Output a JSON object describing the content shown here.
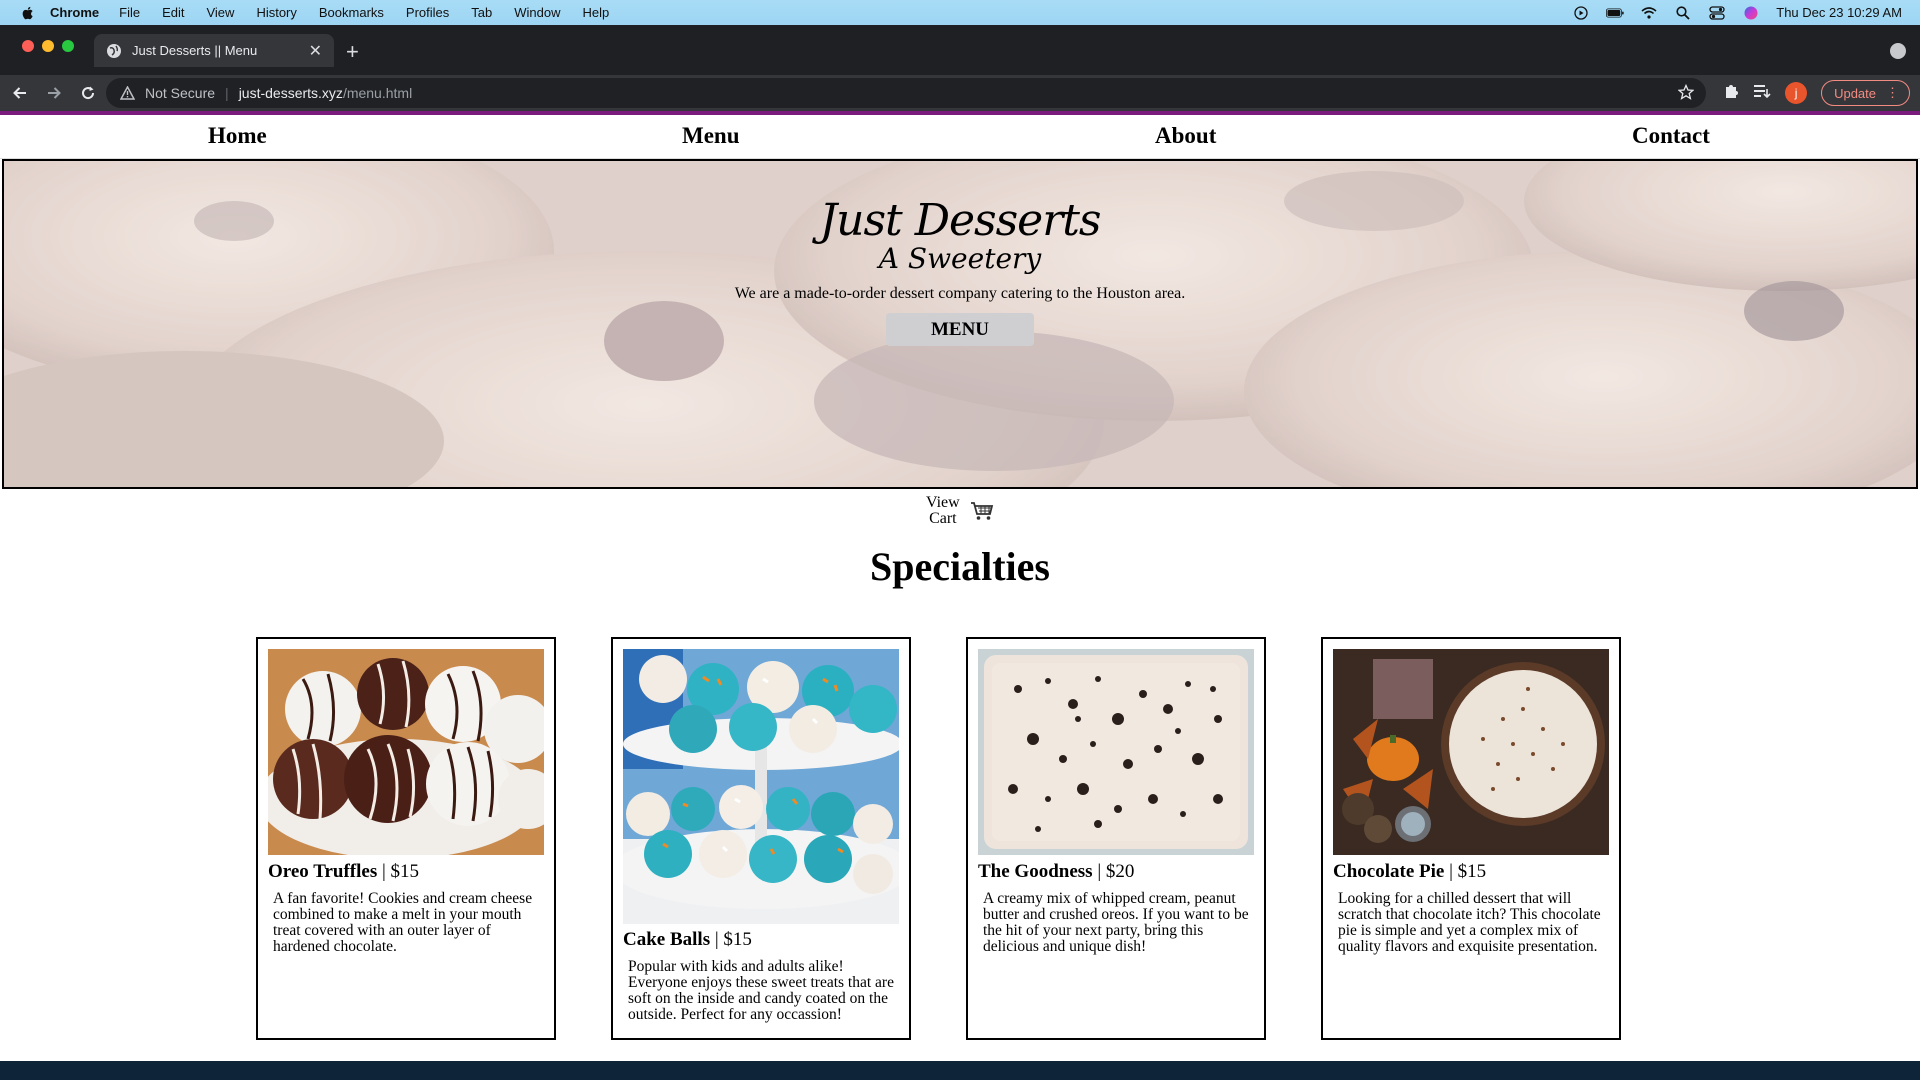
{
  "os_menubar": {
    "app_name": "Chrome",
    "menus": [
      "File",
      "Edit",
      "View",
      "History",
      "Bookmarks",
      "Profiles",
      "Tab",
      "Window",
      "Help"
    ],
    "clock": "Thu Dec 23  10:29 AM"
  },
  "browser": {
    "tab_title": "Just Desserts || Menu",
    "security_label": "Not Secure",
    "url_host": "just-desserts.xyz",
    "url_path": "/menu.html",
    "profile_initial": "j",
    "update_label": "Update"
  },
  "site": {
    "nav": [
      "Home",
      "Menu",
      "About",
      "Contact"
    ],
    "hero": {
      "title": "Just Desserts",
      "subtitle": "A Sweetery",
      "description": "We are a made-to-order dessert company catering to the Houston area.",
      "button": "MENU"
    },
    "cart": {
      "line1": "View",
      "line2": "Cart"
    },
    "section_title": "Specialties",
    "items": [
      {
        "name": "Oreo Truffles",
        "price": " | $15",
        "description": "A fan favorite! Cookies and cream cheese combined to make a melt in your mouth treat covered with an outer layer of hardened chocolate."
      },
      {
        "name": "Cake Balls",
        "price": " | $15",
        "description": "Popular with kids and adults alike! Everyone enjoys these sweet treats that are soft on the inside and candy coated on the outside. Perfect for any occassion!"
      },
      {
        "name": "The Goodness",
        "price": " | $20",
        "description": "A creamy mix of whipped cream, peanut butter and crushed oreos. If you want to be the hit of your next party, bring this delicious and unique dish!"
      },
      {
        "name": "Chocolate Pie",
        "price": " | $15",
        "description": "Looking for a chilled dessert that will scratch that chocolate itch? This chocolate pie is simple and yet a complex mix of quality flavors and exquisite presentation."
      }
    ]
  },
  "colors": {
    "accent_line": "#7b1b7e",
    "hero_button": "#cfcfd2",
    "chrome_dark": "#35363a"
  }
}
